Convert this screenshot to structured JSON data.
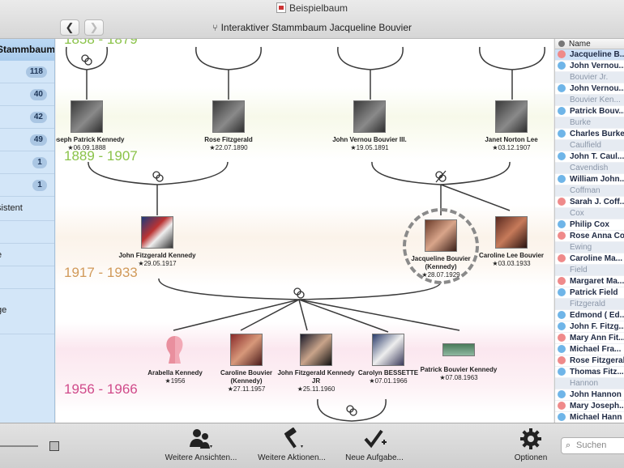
{
  "window": {
    "title": "Beispielbaum",
    "subtitle": "Interaktiver Stammbaum Jacqueline Bouvier",
    "back_label": "❮",
    "forward_label": "❯"
  },
  "sidebar": {
    "header": "Stammbaum",
    "rows": [
      {
        "badge": "118"
      },
      {
        "badge": "40"
      },
      {
        "badge": "42"
      },
      {
        "badge": "49"
      },
      {
        "badge": "1"
      },
      {
        "badge": "1"
      },
      {
        "text": "sistent"
      },
      {
        "text": ""
      },
      {
        "text": "e"
      },
      {
        "text": ""
      },
      {
        "text": "ge"
      }
    ]
  },
  "generations": [
    {
      "label": "1858 - 1879",
      "color": "#8bc34a"
    },
    {
      "label": "1889 - 1907",
      "color": "#8bc34a"
    },
    {
      "label": "1917 - 1933",
      "color": "#d19a5a"
    },
    {
      "label": "1956 - 1966",
      "color": "#d04a8a"
    }
  ],
  "people": {
    "joseph": {
      "name": "Joseph Patrick Kennedy",
      "date": "★06.09.1888"
    },
    "rose": {
      "name": "Rose Fitzgerald",
      "date": "★22.07.1890"
    },
    "john_vernou": {
      "name": "John Vernou Bouvier III.",
      "date": "★19.05.1891"
    },
    "janet": {
      "name": "Janet Norton Lee",
      "date": "★03.12.1907"
    },
    "jfk": {
      "name": "John Fitzgerald Kennedy",
      "date": "★29.05.1917"
    },
    "jackie": {
      "name": "Jacqueline Bouvier (Kennedy)",
      "date": "★28.07.1929"
    },
    "caroline_lee": {
      "name": "Caroline Lee Bouvier",
      "date": "★03.03.1933"
    },
    "arabella": {
      "name": "Arabella Kennedy",
      "date": "★1956"
    },
    "caroline": {
      "name": "Caroline Bouvier (Kennedy)",
      "date": "★27.11.1957"
    },
    "jfk_jr": {
      "name": "John Fitzgerald Kennedy JR",
      "date": "★25.11.1960"
    },
    "carolyn": {
      "name": "Carolyn BESSETTE",
      "date": "★07.01.1966"
    },
    "patrick": {
      "name": "Patrick Bouvier Kennedy",
      "date": "★07.08.1963"
    }
  },
  "list": {
    "header": "Name",
    "rows": [
      {
        "type": "person",
        "name": "Jacqueline B...",
        "color": "#ef8a8a",
        "selected": true
      },
      {
        "type": "person",
        "name": "John Vernou...",
        "color": "#6fb5e8"
      },
      {
        "type": "group",
        "name": "Bouvier Jr."
      },
      {
        "type": "person",
        "name": "John Vernou...",
        "color": "#6fb5e8"
      },
      {
        "type": "group",
        "name": "Bouvier Ken..."
      },
      {
        "type": "person",
        "name": "Patrick Bouv...",
        "color": "#6fb5e8"
      },
      {
        "type": "group",
        "name": "Burke"
      },
      {
        "type": "person",
        "name": "Charles Burke",
        "color": "#6fb5e8"
      },
      {
        "type": "group",
        "name": "Caulfield"
      },
      {
        "type": "person",
        "name": "John T. Caul...",
        "color": "#6fb5e8"
      },
      {
        "type": "group",
        "name": "Cavendish"
      },
      {
        "type": "person",
        "name": "William John...",
        "color": "#6fb5e8"
      },
      {
        "type": "group",
        "name": "Coffman"
      },
      {
        "type": "person",
        "name": "Sarah J. Coff...",
        "color": "#ef8a8a"
      },
      {
        "type": "group",
        "name": "Cox"
      },
      {
        "type": "person",
        "name": "Philip Cox",
        "color": "#6fb5e8"
      },
      {
        "type": "person",
        "name": "Rose Anna Cox",
        "color": "#ef8a8a"
      },
      {
        "type": "group",
        "name": "Ewing"
      },
      {
        "type": "person",
        "name": "Caroline Ma...",
        "color": "#ef8a8a"
      },
      {
        "type": "group",
        "name": "Field"
      },
      {
        "type": "person",
        "name": "Margaret Ma...",
        "color": "#ef8a8a"
      },
      {
        "type": "person",
        "name": "Patrick Field",
        "color": "#6fb5e8"
      },
      {
        "type": "group",
        "name": "Fitzgerald"
      },
      {
        "type": "person",
        "name": "Edmond ( Ed...",
        "color": "#6fb5e8"
      },
      {
        "type": "person",
        "name": "John F. Fitzg...",
        "color": "#6fb5e8"
      },
      {
        "type": "person",
        "name": "Mary Ann Fit...",
        "color": "#ef8a8a"
      },
      {
        "type": "person",
        "name": "Michael Fra...",
        "color": "#6fb5e8"
      },
      {
        "type": "person",
        "name": "Rose Fitzgeral",
        "color": "#ef8a8a"
      },
      {
        "type": "person",
        "name": "Thomas Fitz...",
        "color": "#6fb5e8"
      },
      {
        "type": "group",
        "name": "Hannon"
      },
      {
        "type": "person",
        "name": "John Hannon",
        "color": "#6fb5e8"
      },
      {
        "type": "person",
        "name": "Mary Joseph...",
        "color": "#ef8a8a"
      },
      {
        "type": "person",
        "name": "Michael Hann",
        "color": "#6fb5e8"
      }
    ]
  },
  "toolbar": {
    "views_label": "Weitere Ansichten...",
    "actions_label": "Weitere Aktionen...",
    "task_label": "Neue Aufgabe...",
    "options_label": "Optionen",
    "search_placeholder": "Suchen"
  }
}
